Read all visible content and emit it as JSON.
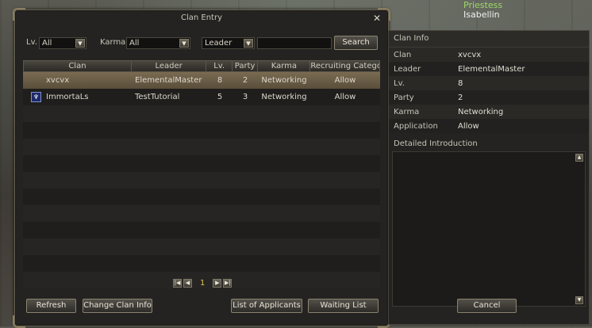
{
  "npc": {
    "title": "Priestess",
    "name": "Isabellin"
  },
  "window": {
    "title": "Clan Entry",
    "close": "✕"
  },
  "filters": {
    "lv_label": "Lv.",
    "lv_value": "All",
    "karma_label": "Karma",
    "karma_value": "All",
    "search_by_value": "Leader",
    "search_text": "",
    "search_button": "Search"
  },
  "table": {
    "headers": [
      "Clan",
      "Leader",
      "Lv.",
      "Party",
      "Karma",
      "Recruiting Category"
    ],
    "rows": [
      {
        "clan": "xvcvx",
        "leader": "ElementalMaster",
        "lv": "8",
        "party": "2",
        "karma": "Networking",
        "recruiting": "Allow",
        "crest": ""
      },
      {
        "clan": "ImmortaLs",
        "leader": "TestTutorial",
        "lv": "5",
        "party": "3",
        "karma": "Networking",
        "recruiting": "Allow",
        "crest": "♆"
      }
    ]
  },
  "pager": {
    "page": "1"
  },
  "buttons": {
    "refresh": "Refresh",
    "change_info": "Change Clan Info",
    "applicants": "List of Applicants",
    "waiting": "Waiting List",
    "cancel": "Cancel"
  },
  "side": {
    "title": "Clan Info",
    "fields": [
      {
        "k": "Clan",
        "v": "xvcvx"
      },
      {
        "k": "Leader",
        "v": "ElementalMaster"
      },
      {
        "k": "Lv.",
        "v": "8"
      },
      {
        "k": "Party",
        "v": "2"
      },
      {
        "k": "Karma",
        "v": "Networking"
      },
      {
        "k": "Application",
        "v": "Allow"
      }
    ],
    "intro_title": "Detailed Introduction"
  },
  "colors": {
    "selected_row": "#7a6b52",
    "page_number": "#e0c050",
    "npc_title": "#9fd86a"
  }
}
